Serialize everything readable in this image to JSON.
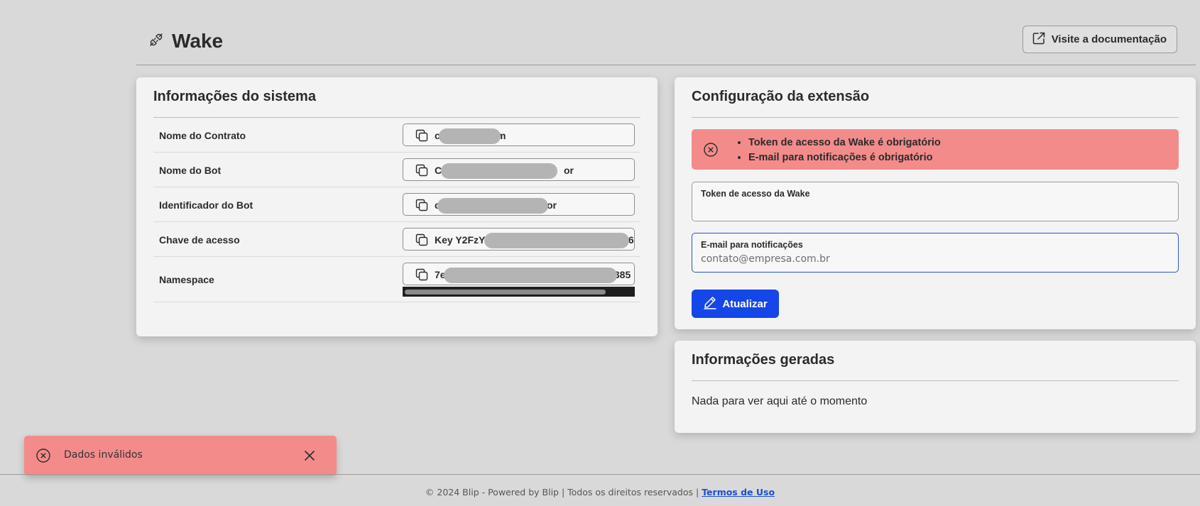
{
  "header": {
    "brand_icon": "plug-icon",
    "title": "Wake",
    "doc_button_icon": "external-link-icon",
    "doc_button_label": "Visite a documentação"
  },
  "system_info": {
    "title": "Informações do sistema",
    "copy_icon": "copy-icon",
    "rows": [
      {
        "label": "Nome do Contrato",
        "value_start": "c",
        "value_end": "m"
      },
      {
        "label": "Nome do Bot",
        "value_start": "C",
        "value_end": "or"
      },
      {
        "label": "Identificador do Bot",
        "value_start": "c",
        "value_end": "or"
      },
      {
        "label": "Chave de acesso",
        "value_start": "Key Y2FzY",
        "value_end": "I6"
      },
      {
        "label": "Namespace",
        "value_start": "7e",
        "value_end": ".385"
      }
    ]
  },
  "config": {
    "title": "Configuração da extensão",
    "alert_icon": "error-circle-icon",
    "errors": [
      "Token de acesso da Wake é obrigatório",
      "E-mail para notificações é obrigatório"
    ],
    "token_field": {
      "label": "Token de acesso da Wake",
      "value": "",
      "placeholder": ""
    },
    "email_field": {
      "label": "E-mail para notificações",
      "value": "",
      "placeholder": "contato@empresa.com.br"
    },
    "update_button_icon": "pencil-icon",
    "update_button_label": "Atualizar"
  },
  "generated": {
    "title": "Informações geradas",
    "empty_text": "Nada para ver aqui até o momento"
  },
  "toast": {
    "icon": "error-circle-icon",
    "message": "Dados inválidos",
    "close_icon": "close-icon"
  },
  "footer": {
    "text": "© 2024 Blip - Powered by Blip | Todos os direitos reservados |",
    "link_label": "Termos de Uso"
  },
  "colors": {
    "background": "#d9d9d9",
    "card": "#f3f3f3",
    "error": "#f48b8b",
    "primary": "#1446e8",
    "focus_border": "#2b55c9"
  }
}
